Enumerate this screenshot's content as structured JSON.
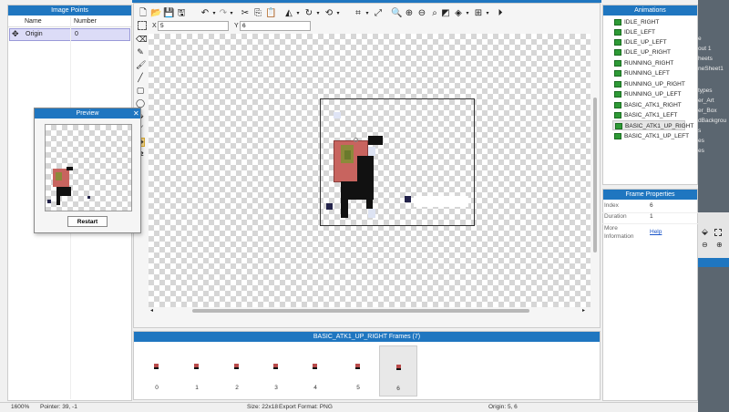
{
  "image_points": {
    "title": "Image Points",
    "col_name": "Name",
    "col_number": "Number",
    "rows": [
      {
        "name": "Origin",
        "number": "0"
      }
    ]
  },
  "preview": {
    "title": "Preview",
    "restart_label": "Restart"
  },
  "toolbar": {
    "x_label": "X",
    "x_value": "5",
    "y_label": "Y",
    "y_value": "6"
  },
  "animations": {
    "title": "Animations",
    "items": [
      "IDLE_RIGHT",
      "IDLE_LEFT",
      "IDLE_UP_LEFT",
      "IDLE_UP_RIGHT",
      "RUNNING_RIGHT",
      "RUNNING_LEFT",
      "RUNNING_UP_RIGHT",
      "RUNNING_UP_LEFT",
      "BASIC_ATK1_RIGHT",
      "BASIC_ATK1_LEFT",
      "BASIC_ATK1_UP_RIGHT",
      "BASIC_ATK1_UP_LEFT"
    ],
    "selected": "BASIC_ATK1_UP_RIGHT"
  },
  "frame_properties": {
    "title": "Frame Properties",
    "index_label": "Index",
    "index_value": "6",
    "duration_label": "Duration",
    "duration_value": "1",
    "more_label_1": "More",
    "more_label_2": "Information",
    "help_link": "Help"
  },
  "frames": {
    "title": "BASIC_ATK1_UP_RIGHT Frames (7)",
    "items": [
      "0",
      "1",
      "2",
      "3",
      "4",
      "5",
      "6"
    ],
    "selected": "6"
  },
  "status": {
    "zoom": "1600%",
    "pointer": "Pointer: 39, -1",
    "size": "Size: 22x18",
    "export_format": "Export Format: PNG",
    "origin": "Origin: 5, 6"
  },
  "background_window": {
    "items": [
      "types",
      "er_Art",
      "er_Box",
      "dBackgrou",
      "s",
      "es",
      "es"
    ],
    "top_items": [
      "e",
      "out 1",
      "heets",
      "neSheet1"
    ]
  },
  "colors": {
    "accent": "#1f76c0",
    "selection": "#dcdcf7",
    "sprite_skin": "#c8645f",
    "sprite_face": "#8b8a3a",
    "sprite_body": "#111111"
  }
}
